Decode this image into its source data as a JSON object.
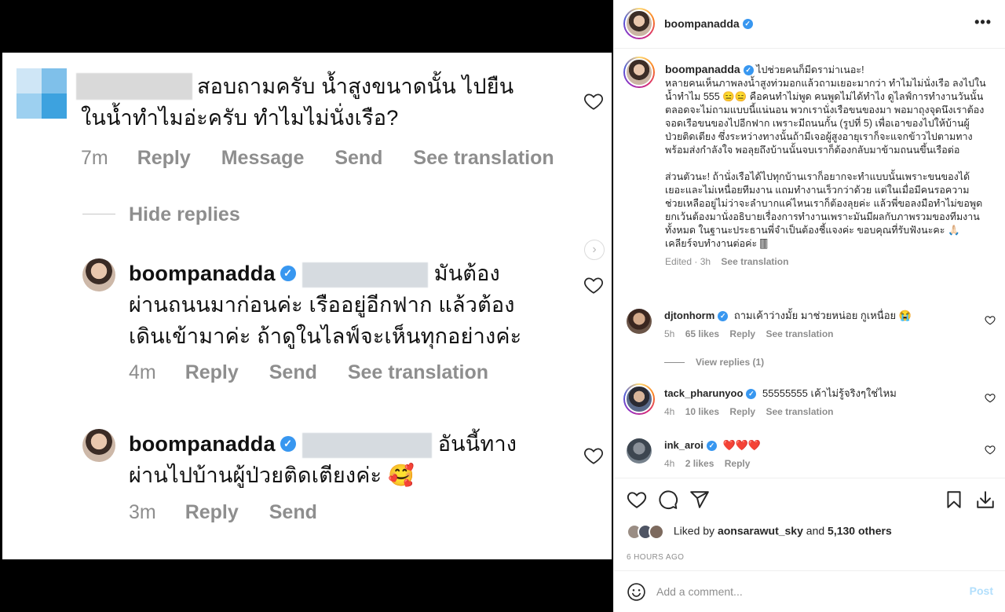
{
  "media": {
    "comment1": {
      "text_line1": "สอบถามครับ น้ำสูงขนาดนั้น ไปยืน",
      "text_line2": "ในน้ำทำไมอ่ะครับ ทำไมไม่นั่งเรือ?",
      "time": "7m",
      "reply": "Reply",
      "message": "Message",
      "send": "Send",
      "see_translation": "See translation"
    },
    "hide_replies": "Hide replies",
    "reply1": {
      "username": "boompanadda",
      "text_line1": "มันต้อง",
      "text_line2": "ผ่านถนนมาก่อนค่ะ เรืออยู่อีกฟาก แล้วต้อง",
      "text_line3": "เดินเข้ามาค่ะ ถ้าดูในไลฟ์จะเห็นทุกอย่างค่ะ",
      "time": "4m",
      "reply": "Reply",
      "send": "Send",
      "see_translation": "See translation"
    },
    "reply2": {
      "username": "boompanadda",
      "text_line1": "อันนี้ทาง",
      "text_line2": "ผ่านไปบ้านผู้ป่วยติดเตียงค่ะ 🥰",
      "time": "3m",
      "reply": "Reply",
      "send": "Send"
    }
  },
  "header": {
    "username": "boompanadda",
    "more": "•••"
  },
  "caption": {
    "username": "boompanadda",
    "text": "ไปช่วยคนก็มีดราม่าเนอะ!\nหลายคนเห็นภาพลงน้ำสูงท่วมอกแล้วถามเยอะมากว่า ทำไมไม่นั่งเรือ ลงไปในน้ำทำไม 555 😑😑 คือคนทำไม่พูด คนพูดไม่ได้ทำไง ดูไลฟ์การทำงานวันนั้นตลอดจะไม่ถามแบบนี้แน่นอน พวกเรานั่งเรือขนของมา พอมาถุงจุดนึงเราต้องจอดเรือขนของไปอีกฟาก เพราะมีถนนกั้น (รูปที่ 5) เพื่อเอาของไปให้บ้านผู้ป่วยติดเตียง ซึ่งระหว่างทางนั้นถ้ามีเจอผู้สูงอายุเราก็จะแจกข้าวไปตามทางพร้อมส่งกำลังใจ พอลุยถึงบ้านนั้นจบเราก็ต้องกลับมาข้ามถนนขึ้นเรือต่อ\n\nส่วนตัวนะ! ถ้านั่งเรือได้ไปทุกบ้านเราก็อยากจะทำแบบนั้นเพราะขนของได้เยอะและไม่เหนื่อยทีมงาน แถมทำงานเร็วกว่าด้วย แต่ในเมื่อมีคนรอความช่วยเหลืออยู่ไม่ว่าจะลำบากแค่ไหนเราก็ต้องลุยค่ะ แล้วพี่ขอลงมือทำไม่ขอพูด ยกเว้นต้องมานั่งอธิบายเรื่องการทำงานเพราะมันมีผลกับภาพรวมของทีมงานทั้งหมด ในฐานะประธานพี่จำเป็นต้องชี้แจงค่ะ ขอบคุณที่รับฟังนะคะ 🙏🏻 เคลียร์จบทำงานต่อค่ะ 🀫",
    "edited": "Edited · 3h",
    "see_translation": "See translation"
  },
  "comments": [
    {
      "username": "djtonhorm",
      "text": "ถามเค้าว่างมั้ย มาช่วยหน่อย กูเหนื่อย 😭",
      "time": "5h",
      "likes": "65 likes",
      "reply": "Reply",
      "see_translation": "See translation"
    },
    {
      "username": "tack_pharunyoo",
      "text": "55555555 เค้าไม่รู้จริงๆใช่ไหม",
      "time": "4h",
      "likes": "10 likes",
      "reply": "Reply",
      "see_translation": "See translation"
    },
    {
      "username": "ink_aroi",
      "text": "❤️❤️❤️",
      "time": "4h",
      "likes": "2 likes",
      "reply": "Reply"
    }
  ],
  "view_replies": "View replies (1)",
  "likes_line": {
    "prefix": "Liked by",
    "user": "aonsarawut_sky",
    "and": "and",
    "others": "5,130 others"
  },
  "time_ago": "6 HOURS AGO",
  "add_comment": {
    "placeholder": "Add a comment...",
    "post": "Post"
  },
  "icons": {
    "like": "heart-icon",
    "comment": "comment-icon",
    "share": "share-icon",
    "save": "bookmark-icon",
    "download": "download-icon",
    "emoji": "emoji-icon"
  },
  "colors": {
    "verified": "#3897f0",
    "muted": "#8e8e8e",
    "post_disabled": "#b2dffc"
  }
}
